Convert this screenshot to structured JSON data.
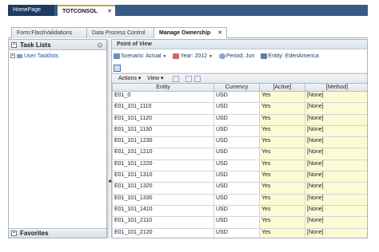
{
  "app_tabs": {
    "home": "HomePage",
    "consol": "TOTCONSOL",
    "close": "✕"
  },
  "doc_tabs": {
    "t1": "Form:FlashValidations",
    "t2": "Data Process Control",
    "t3": "Manage Ownership",
    "close": "✕"
  },
  "left_panel": {
    "title": "Task Lists",
    "item": "User Tasklists",
    "favorites": "Favorites"
  },
  "pov": {
    "title": "Point of View",
    "scenario": "Scenario: Actual",
    "year": "Year: 2012",
    "period": "Period: Jun",
    "entity": "Entity: EdenAmerica"
  },
  "toolbar": {
    "actions": "Actions",
    "view": "View"
  },
  "grid": {
    "columns": [
      "Entity",
      "Currency",
      "[Active]",
      "[Method]"
    ],
    "rows": [
      [
        "E01_0",
        "USD",
        "Yes",
        "[None]"
      ],
      [
        "E01_101_1110",
        "USD",
        "Yes",
        "[None]"
      ],
      [
        "E01_101_1120",
        "USD",
        "Yes",
        "[None]"
      ],
      [
        "E01_101_1130",
        "USD",
        "Yes",
        "[None]"
      ],
      [
        "E01_101_1230",
        "USD",
        "Yes",
        "[None]"
      ],
      [
        "E01_101_1210",
        "USD",
        "Yes",
        "[None]"
      ],
      [
        "E01_101_1220",
        "USD",
        "Yes",
        "[None]"
      ],
      [
        "E01_101_1310",
        "USD",
        "Yes",
        "[None]"
      ],
      [
        "E01_101_1320",
        "USD",
        "Yes",
        "[None]"
      ],
      [
        "E01_101_1330",
        "USD",
        "Yes",
        "[None]"
      ],
      [
        "E01_101_1410",
        "USD",
        "Yes",
        "[None]"
      ],
      [
        "E01_101_2110",
        "USD",
        "Yes",
        "[None]"
      ],
      [
        "E01_101_2120",
        "USD",
        "Yes",
        "[None]"
      ]
    ]
  },
  "colors": {
    "nav_bar": "#3a5a86",
    "active_cell": "#fdfbd4",
    "link": "#1f4f9a"
  }
}
